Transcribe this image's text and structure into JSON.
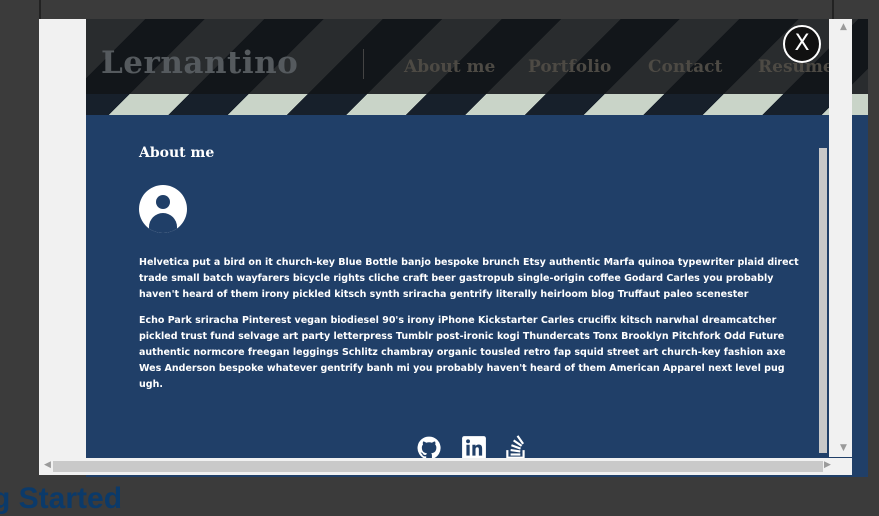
{
  "background": {
    "section_heading": "g Started"
  },
  "site": {
    "logo": "Lernantino",
    "nav": [
      "About me",
      "Portfolio",
      "Contact",
      "Resume"
    ]
  },
  "about": {
    "title": "About me",
    "paragraphs": [
      "Helvetica put a bird on it church-key Blue Bottle banjo bespoke brunch Etsy authentic Marfa quinoa typewriter plaid direct trade small batch wayfarers bicycle rights cliche craft beer gastropub single-origin coffee Godard Carles you probably haven't heard of them irony pickled kitsch synth sriracha gentrify literally heirloom blog Truffaut paleo scenester",
      "Echo Park sriracha Pinterest vegan biodiesel 90's irony iPhone Kickstarter Carles crucifix kitsch narwhal dreamcatcher pickled trust fund selvage art party letterpress Tumblr post-ironic kogi Thundercats Tonx Brooklyn Pitchfork Odd Future authentic normcore freegan leggings Schlitz chambray organic tousled retro fap squid street art church-key fashion axe Wes Anderson bespoke whatever gentrify banh mi you probably haven't heard of them American Apparel next level pug ugh."
    ]
  },
  "social_icons": [
    "github-icon",
    "linkedin-icon",
    "stackoverflow-icon"
  ],
  "lightbox": {
    "close_label": "X"
  },
  "colors": {
    "about_bg": "#203f68",
    "header_dark": "#121418",
    "stripe_light": "#c9d4c8"
  }
}
